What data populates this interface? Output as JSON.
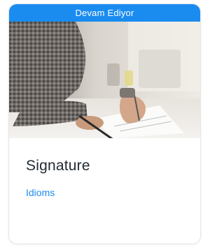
{
  "card": {
    "status_label": "Devam Ediyor",
    "title": "Signature",
    "category": "Idioms",
    "image_alt_icon": "signing-document-photo"
  },
  "colors": {
    "accent": "#1a8cf0",
    "title": "#222a33",
    "border": "#e3e6ea"
  }
}
